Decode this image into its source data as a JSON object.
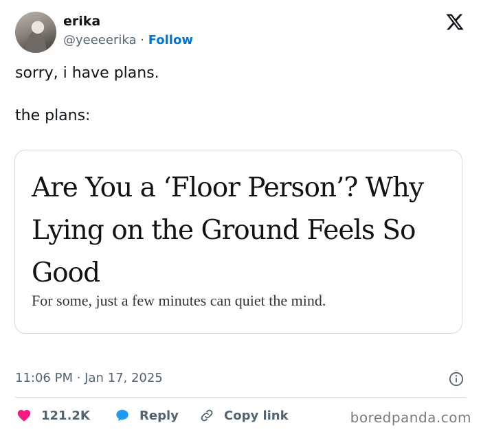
{
  "author": {
    "name": "erika",
    "handle": "@yeeeerika",
    "separator": "·",
    "follow_label": "Follow"
  },
  "tweet": {
    "line1": "sorry, i have plans.",
    "line2": "the plans:"
  },
  "card": {
    "headline": "Are You a ‘Floor Person’? Why Lying on the Ground Feels So Good",
    "subheadline": "For some, just a few minutes can quiet the mind."
  },
  "meta": {
    "timestamp": "11:06 PM · Jan 17, 2025"
  },
  "actions": {
    "like_count": "121.2K",
    "reply_label": "Reply",
    "copy_label": "Copy link"
  },
  "watermark": "boredpanda.com",
  "icons": [
    "x-logo-icon",
    "info-icon",
    "heart-icon",
    "reply-bubble-icon",
    "link-icon"
  ],
  "colors": {
    "follow": "#0074d4",
    "heart": "#f91880",
    "reply_bubble": "#1d9bf0",
    "muted": "#536471"
  }
}
